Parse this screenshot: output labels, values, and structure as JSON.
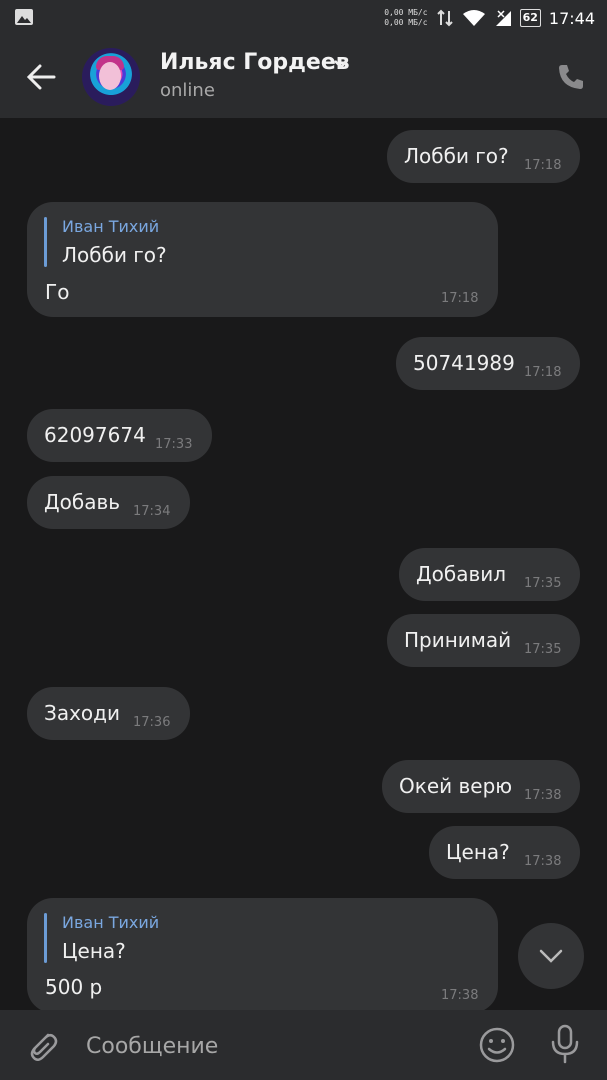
{
  "status_bar": {
    "speed_up": "0,00 МБ/с",
    "speed_down": "0,00 МБ/с",
    "battery": "62",
    "time": "17:44"
  },
  "header": {
    "contact_name": "Ильяс Гордеев",
    "status": "online"
  },
  "messages": [
    {
      "text": "Лобби го?",
      "time": "17:18",
      "side": "right"
    },
    {
      "quote_author": "Иван Тихий",
      "quote_text": "Лобби го?",
      "text": "Го",
      "time": "17:18",
      "side": "left"
    },
    {
      "text": "50741989",
      "time": "17:18",
      "side": "right"
    },
    {
      "text": "62097674",
      "time": "17:33",
      "side": "left"
    },
    {
      "text": "Добавь",
      "time": "17:34",
      "side": "left"
    },
    {
      "text": "Добавил",
      "time": "17:35",
      "side": "right"
    },
    {
      "text": "Принимай",
      "time": "17:35",
      "side": "right"
    },
    {
      "text": "Заходи",
      "time": "17:36",
      "side": "left"
    },
    {
      "text": "Окей верю",
      "time": "17:38",
      "side": "right"
    },
    {
      "text": "Цена?",
      "time": "17:38",
      "side": "right"
    },
    {
      "quote_author": "Иван Тихий",
      "quote_text": "Цена?",
      "text": "500 р",
      "time": "17:38",
      "side": "left"
    }
  ],
  "composer": {
    "placeholder": "Сообщение"
  },
  "colors": {
    "background": "#19191a",
    "bubble": "#333436",
    "bar": "#2b2c2e",
    "quote_accent": "#6c9cd6"
  },
  "icons": [
    "gallery-icon",
    "arrows-updown-icon",
    "wifi-icon",
    "signal-icon",
    "battery-icon",
    "back-arrow-icon",
    "chevron-down-icon",
    "phone-icon",
    "paperclip-icon",
    "emoji-icon",
    "microphone-icon",
    "scroll-down-icon"
  ]
}
